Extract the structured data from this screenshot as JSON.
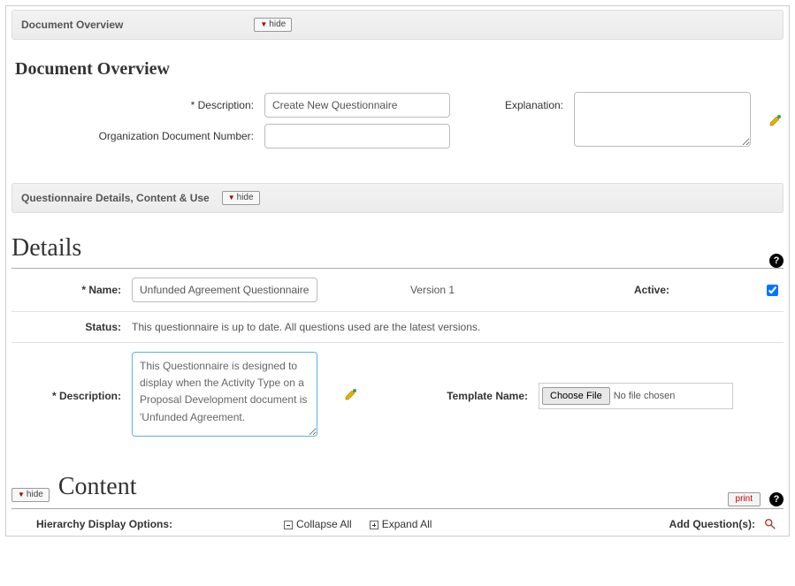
{
  "buttons": {
    "hide": "hide",
    "print": "print",
    "choose_file": "Choose File"
  },
  "overview": {
    "header_title": "Document Overview",
    "title": "Document Overview",
    "desc_label": "*   Description:",
    "desc_value": "Create New Questionnaire",
    "org_doc_label": "Organization Document Number:",
    "org_doc_value": "",
    "explanation_label": "Explanation:",
    "explanation_value": ""
  },
  "qn_section": {
    "header_title": "Questionnaire Details, Content & Use"
  },
  "details": {
    "title": "Details",
    "name_label": "*   Name:",
    "name_value": "Unfunded Agreement Questionnaire",
    "version_label": "Version 1",
    "active_label": "Active:",
    "active_checked": true,
    "status_label": "Status:",
    "status_text": "This questionnaire is up to date. All questions used are the latest versions.",
    "desc_label": "*   Description:",
    "desc_value": "This Questionnaire is designed to display when the Activity Type on a Proposal Development document is 'Unfunded Agreement.",
    "template_label": "Template Name:",
    "file_status": "No file chosen"
  },
  "content": {
    "title": "Content",
    "hdo_label": "Hierarchy Display Options:",
    "collapse": "Collapse All",
    "expand": "Expand All",
    "add_q": "Add Question(s):"
  }
}
